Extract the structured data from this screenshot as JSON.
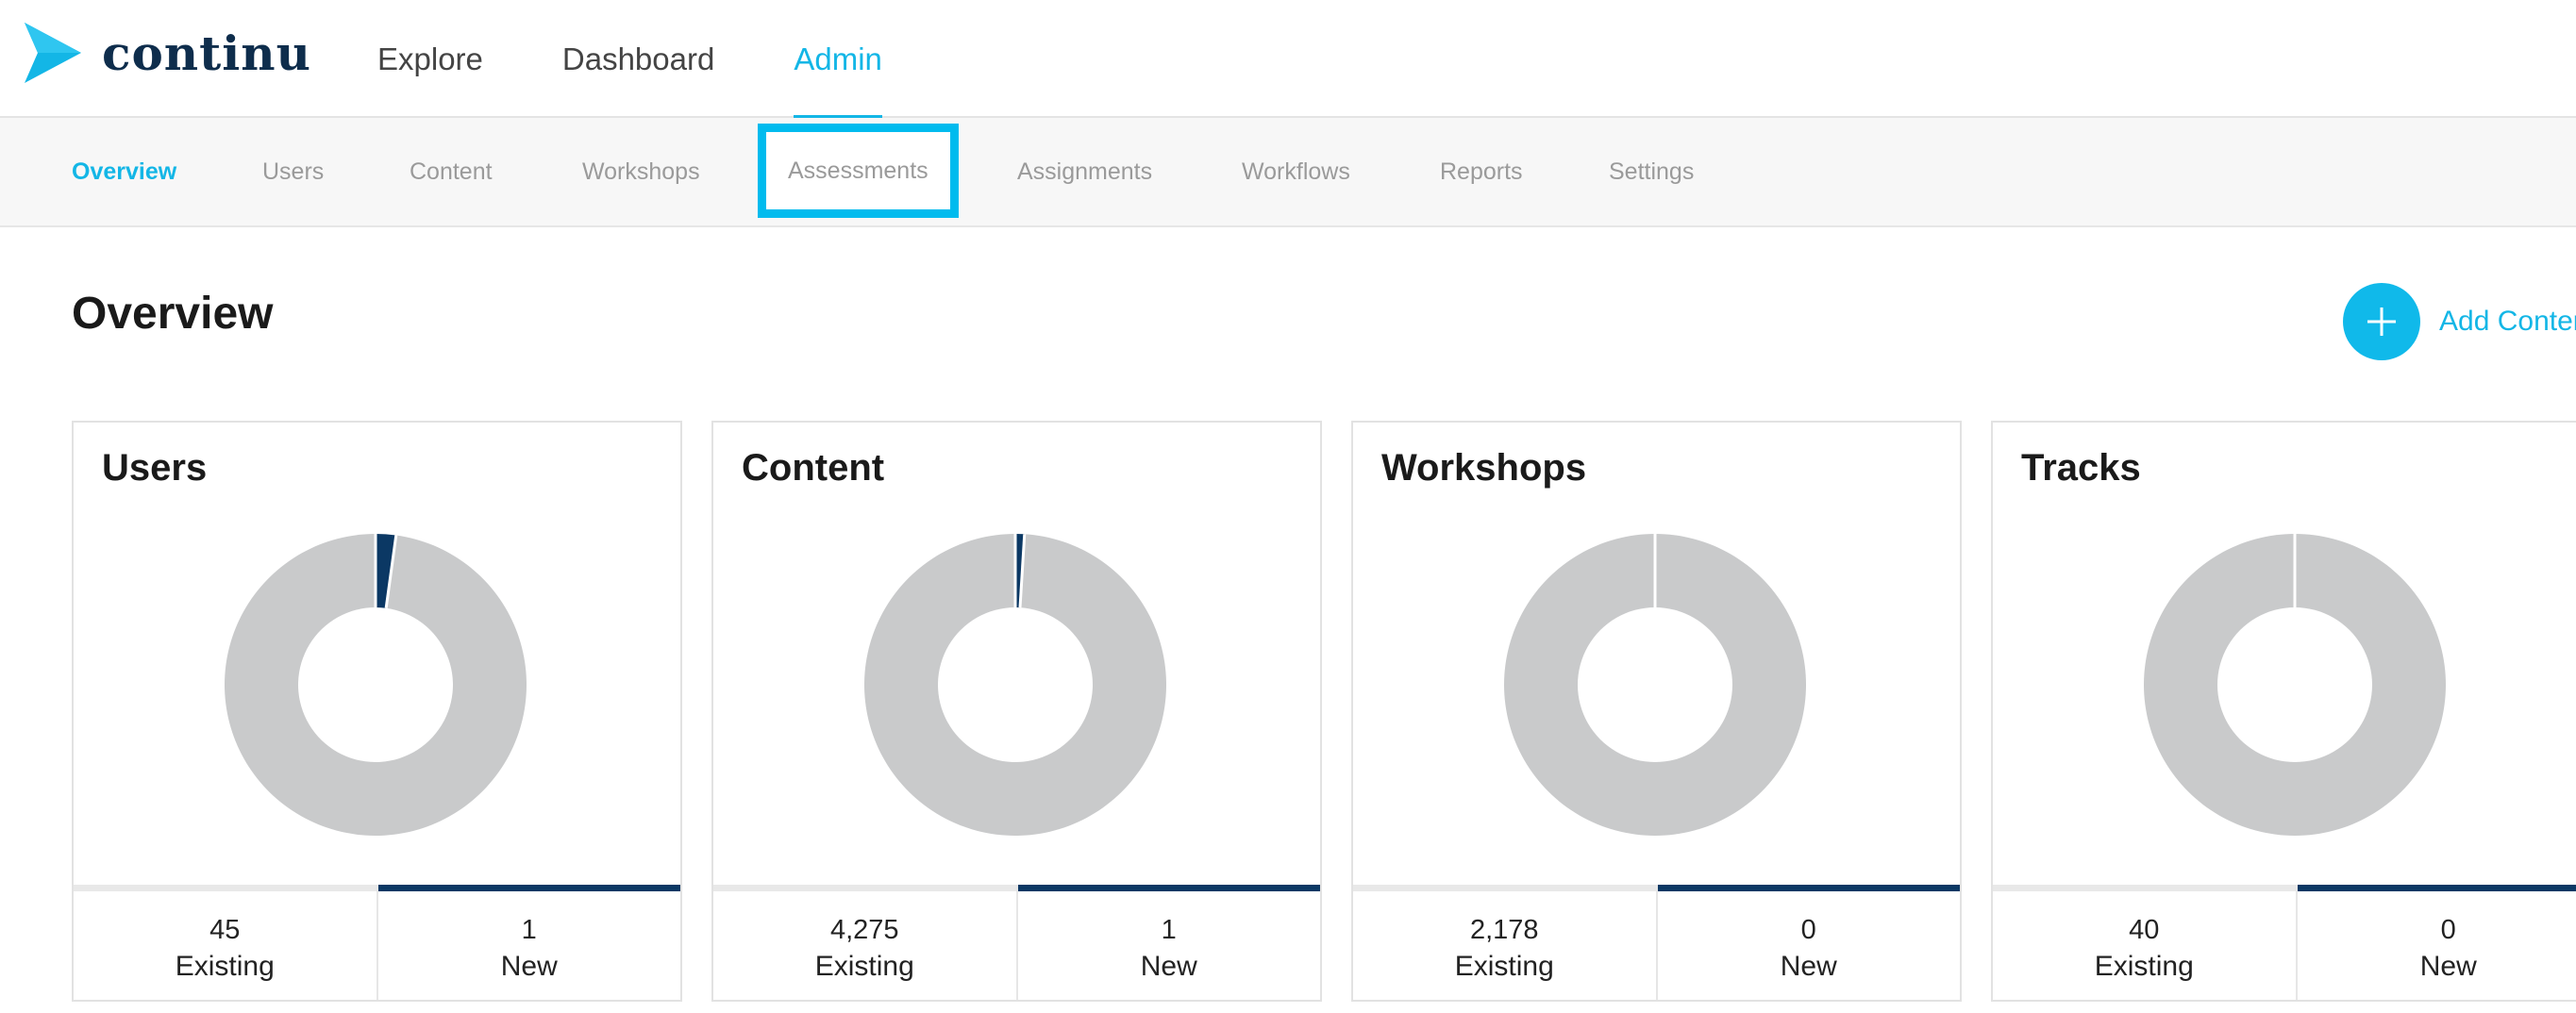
{
  "brand": {
    "name": "continu",
    "color": "#0e2d4c",
    "accent": "#13b6e6"
  },
  "main_nav": [
    {
      "label": "Explore",
      "active": false
    },
    {
      "label": "Dashboard",
      "active": false
    },
    {
      "label": "Admin",
      "active": true
    }
  ],
  "sub_nav": [
    {
      "label": "Overview",
      "active": true
    },
    {
      "label": "Users"
    },
    {
      "label": "Content"
    },
    {
      "label": "Workshops"
    },
    {
      "label": "Assessments",
      "highlighted": true
    },
    {
      "label": "Assignments"
    },
    {
      "label": "Workflows"
    },
    {
      "label": "Reports"
    },
    {
      "label": "Settings"
    }
  ],
  "page": {
    "title": "Overview",
    "add_button": {
      "label": "Add Conten",
      "icon": "plus-icon"
    }
  },
  "cards": [
    {
      "title": "Users",
      "existing": "45",
      "existing_label": "Existing",
      "new": "1",
      "new_label": "New",
      "existing_count": 45,
      "new_count": 1
    },
    {
      "title": "Content",
      "existing": "4,275",
      "existing_label": "Existing",
      "new": "1",
      "new_label": "New",
      "existing_count": 4275,
      "new_count": 1
    },
    {
      "title": "Workshops",
      "existing": "2,178",
      "existing_label": "Existing",
      "new": "0",
      "new_label": "New",
      "existing_count": 2178,
      "new_count": 0
    },
    {
      "title": "Tracks",
      "existing": "40",
      "existing_label": "Existing",
      "new": "0",
      "new_label": "New",
      "existing_count": 40,
      "new_count": 0
    }
  ],
  "colors": {
    "donut_existing": "#c9cacb",
    "donut_new": "#0b3864",
    "highlight_box": "#00bbee"
  }
}
